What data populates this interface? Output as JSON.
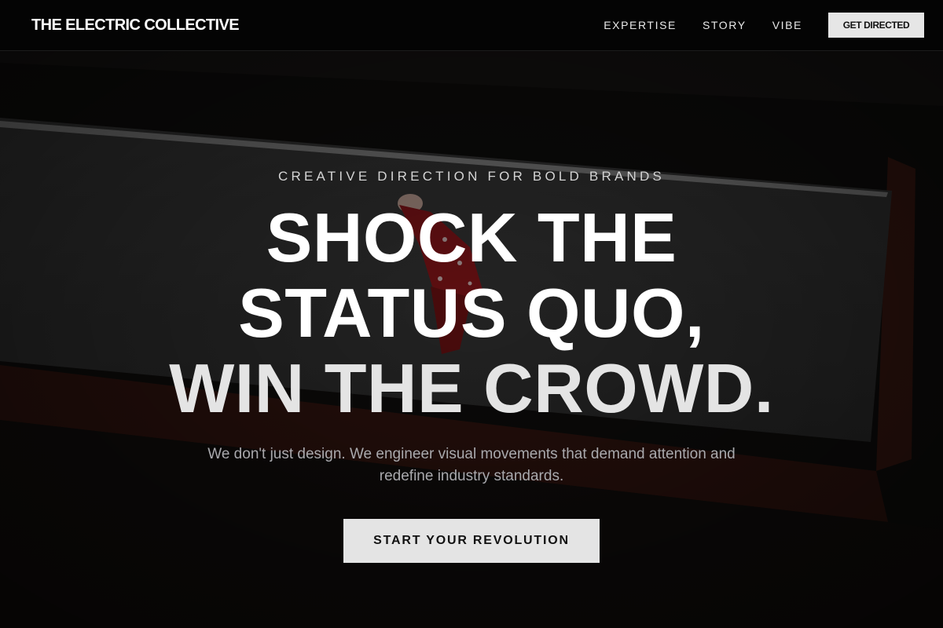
{
  "header": {
    "brand": "THE ELECTRIC COLLECTIVE",
    "nav": [
      {
        "label": "EXPERTISE"
      },
      {
        "label": "STORY"
      },
      {
        "label": "VIBE"
      }
    ],
    "cta_label": "GET DIRECTED"
  },
  "hero": {
    "eyebrow": "CREATIVE DIRECTION FOR BOLD BRANDS",
    "headline": [
      "SHOCK THE",
      "STATUS QUO,",
      "WIN THE CROWD."
    ],
    "subtext": "We don't just design. We engineer visual movements that demand attention and redefine industry standards.",
    "cta_label": "START YOUR REVOLUTION",
    "background_image_description": "dark overhead photo of a person in red on a grey concrete ramp"
  },
  "colors": {
    "page_background": "#050505",
    "header_background": "#040404",
    "button_background": "#e4e4e4",
    "accent_red": "#a8191c",
    "text_primary": "#ffffff",
    "text_muted": "#a9a9ad"
  }
}
